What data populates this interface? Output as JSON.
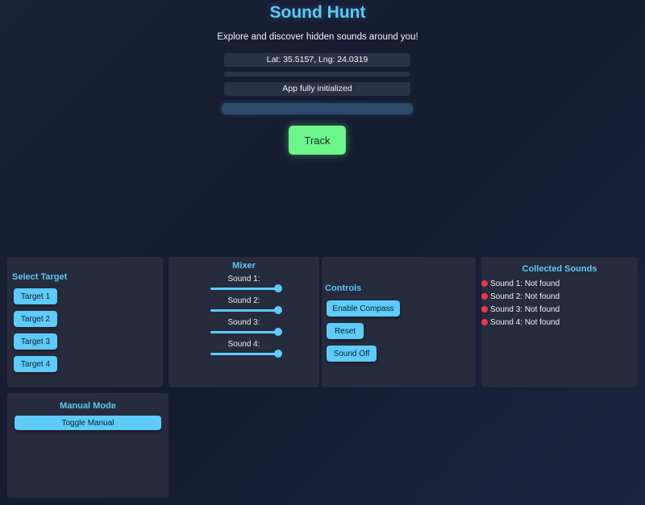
{
  "header": {
    "title": "Sound Hunt",
    "subtitle": "Explore and discover hidden sounds around you!"
  },
  "location": {
    "coords_text": "Lat: 35.5157, Lng: 24.0319"
  },
  "status": {
    "message": "App fully initialized"
  },
  "track_button": {
    "label": "Track"
  },
  "select_target": {
    "heading": "Select Target",
    "targets": [
      "Target 1",
      "Target 2",
      "Target 3",
      "Target 4"
    ]
  },
  "mixer": {
    "heading": "Mixer",
    "channels": [
      {
        "label": "Sound 1:",
        "level": 1.0
      },
      {
        "label": "Sound 2:",
        "level": 1.0
      },
      {
        "label": "Sound 3:",
        "level": 1.0
      },
      {
        "label": "Sound 4:",
        "level": 1.0
      }
    ]
  },
  "controls": {
    "heading": "Controls",
    "enable_compass": "Enable Compass",
    "reset": "Reset",
    "sound_off": "Sound Off"
  },
  "collected": {
    "heading": "Collected Sounds",
    "items": [
      "Sound 1: Not found",
      "Sound 2: Not found",
      "Sound 3: Not found",
      "Sound 4: Not found"
    ]
  },
  "manual_mode": {
    "heading": "Manual Mode",
    "toggle_label": "Toggle Manual"
  },
  "colors": {
    "accent": "#5ec8f5",
    "track_green": "#6bf58a",
    "not_found_red": "#e8384a",
    "panel": "#262b3d"
  }
}
